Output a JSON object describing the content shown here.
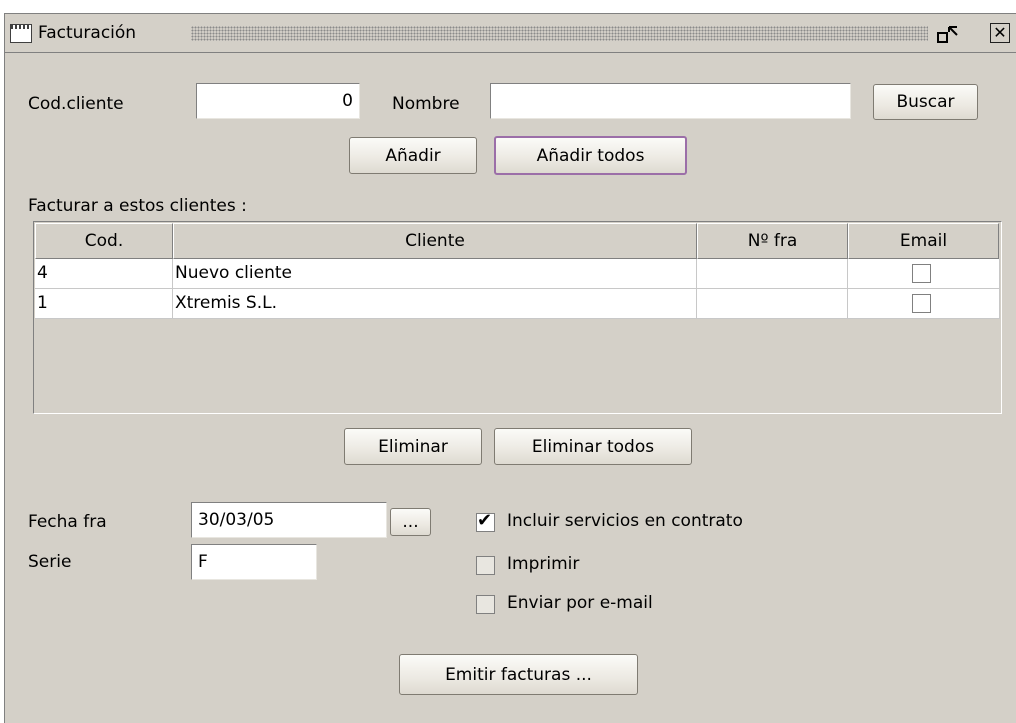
{
  "window": {
    "title": "Facturación"
  },
  "search": {
    "cod_label": "Cod.cliente",
    "cod_value": "0",
    "nombre_label": "Nombre",
    "nombre_value": "",
    "buscar_label": "Buscar",
    "anadir_label": "Añadir",
    "anadir_todos_label": "Añadir todos"
  },
  "clients": {
    "section_label": "Facturar a estos clientes :",
    "columns": [
      "Cod.",
      "Cliente",
      "Nº fra",
      "Email"
    ],
    "rows": [
      {
        "cod": "4",
        "cliente": "Nuevo cliente",
        "nfra": "",
        "email": false
      },
      {
        "cod": "1",
        "cliente": "Xtremis S.L.",
        "nfra": "",
        "email": false
      }
    ],
    "eliminar_label": "Eliminar",
    "eliminar_todos_label": "Eliminar todos"
  },
  "options": {
    "fecha_label": "Fecha fra",
    "fecha_value": "30/03/05",
    "date_picker_label": "...",
    "serie_label": "Serie",
    "serie_value": "F",
    "incluir_label": "Incluir servicios en contrato",
    "incluir_checked": true,
    "imprimir_label": "Imprimir",
    "imprimir_checked": false,
    "enviar_label": "Enviar por e-mail",
    "enviar_checked": false
  },
  "footer": {
    "emitir_label": "Emitir facturas ..."
  },
  "icons": {
    "window": "window-icon",
    "restore": "restore-icon",
    "close": "close-icon",
    "check": "checkmark-icon"
  }
}
